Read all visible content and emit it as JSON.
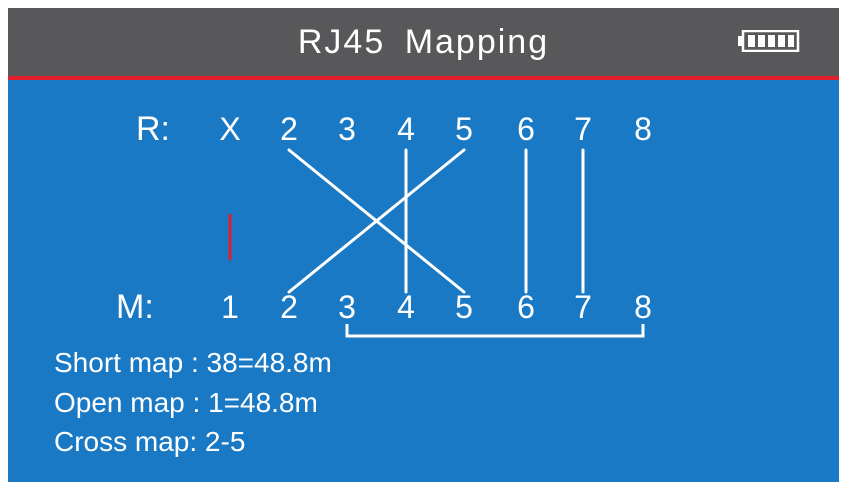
{
  "header": {
    "title": "RJ45 Mapping",
    "battery_icon": "battery-full-icon"
  },
  "wire_map": {
    "remote_label": "R:",
    "main_label": "M:",
    "remote_pins": [
      "X",
      "2",
      "3",
      "4",
      "5",
      "6",
      "7",
      "8"
    ],
    "main_pins": [
      "1",
      "2",
      "3",
      "4",
      "5",
      "6",
      "7",
      "8"
    ],
    "connections": [
      {
        "remote": "2",
        "main": "5"
      },
      {
        "remote": "5",
        "main": "2"
      },
      {
        "remote": "4",
        "main": "4"
      },
      {
        "remote": "6",
        "main": "6"
      },
      {
        "remote": "7",
        "main": "7"
      }
    ],
    "open_pins": [
      "1"
    ],
    "short_pairs": [
      [
        "3",
        "8"
      ]
    ]
  },
  "results": {
    "short_map": "Short map : 38=48.8m",
    "open_map": "Open map : 1=48.8m",
    "cross_map": "Cross map: 2-5"
  },
  "colors": {
    "background": "#1a79c4",
    "header": "#58585a",
    "accent_red": "#e01f2a",
    "text": "#ffffff"
  }
}
